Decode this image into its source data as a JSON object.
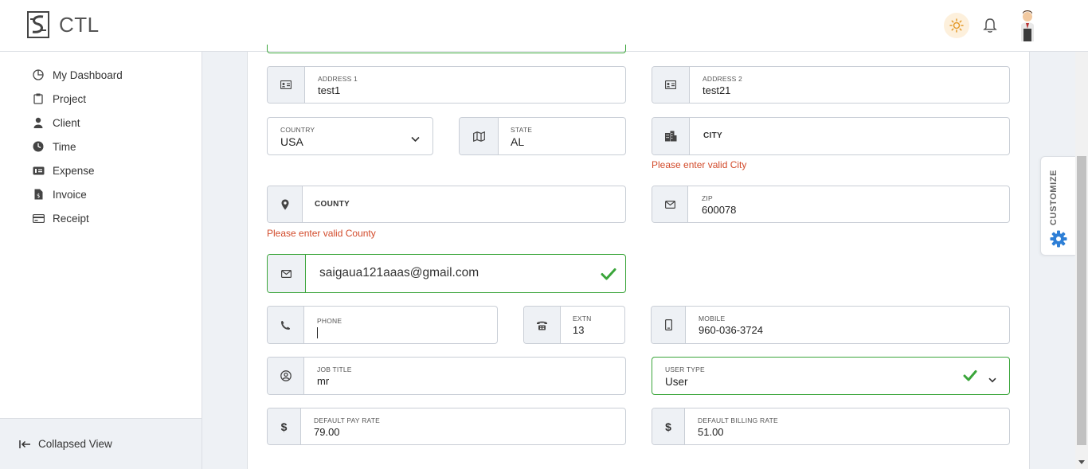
{
  "app": {
    "brand": "CTL"
  },
  "sidebar": {
    "items": [
      {
        "label": "My Dashboard",
        "icon": "pie-chart-icon"
      },
      {
        "label": "Project",
        "icon": "clipboard-icon"
      },
      {
        "label": "Client",
        "icon": "person-icon"
      },
      {
        "label": "Time",
        "icon": "clock-icon"
      },
      {
        "label": "Expense",
        "icon": "money-icon"
      },
      {
        "label": "Invoice",
        "icon": "invoice-icon"
      },
      {
        "label": "Receipt",
        "icon": "receipt-icon"
      }
    ],
    "collapse_label": "Collapsed View"
  },
  "form": {
    "address1": {
      "label": "ADDRESS 1",
      "value": "test1"
    },
    "address2": {
      "label": "ADDRESS 2",
      "value": "test21"
    },
    "country": {
      "label": "COUNTRY",
      "value": "USA"
    },
    "state": {
      "label": "STATE",
      "value": "AL"
    },
    "city": {
      "placeholder": "CITY",
      "error": "Please enter valid City"
    },
    "county": {
      "placeholder": "COUNTY",
      "error": "Please enter valid County"
    },
    "zip": {
      "label": "ZIP",
      "value": "600078"
    },
    "email": {
      "value": "saigaua121aaas@gmail.com"
    },
    "phone": {
      "label": "PHONE",
      "value": ""
    },
    "extn": {
      "label": "EXTN",
      "value": "13"
    },
    "mobile": {
      "label": "MOBILE",
      "value": "960-036-3724"
    },
    "job_title": {
      "label": "JOB TITLE",
      "value": "mr"
    },
    "user_type": {
      "label": "USER TYPE",
      "value": "User"
    },
    "pay_rate": {
      "label": "DEFAULT PAY RATE",
      "value": "79.00",
      "symbol": "$"
    },
    "billing_rate": {
      "label": "DEFAULT BILLING RATE",
      "value": "51.00",
      "symbol": "$"
    }
  },
  "customize_label": "CUSTOMIZE",
  "colors": {
    "valid": "#3aa53a",
    "error": "#d24a2a",
    "accent": "#2e7fd6",
    "addon_bg": "#eef1f5"
  }
}
